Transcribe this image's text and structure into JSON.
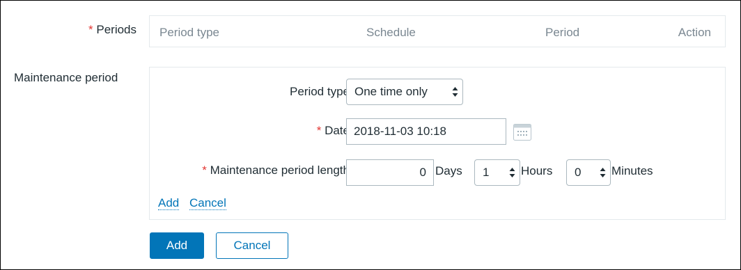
{
  "periods": {
    "required_mark": "*",
    "label": "Periods",
    "columns": [
      "Period type",
      "Schedule",
      "Period",
      "Action"
    ]
  },
  "maintenance_period": {
    "label": "Maintenance period",
    "period_type": {
      "label": "Period type",
      "value": "One time only"
    },
    "date": {
      "required_mark": "*",
      "label": "Date",
      "value": "2018-11-03 10:18"
    },
    "length": {
      "required_mark": "*",
      "label": "Maintenance period length",
      "days_value": "0",
      "days_unit": "Days",
      "hours_value": "1",
      "hours_unit": "Hours",
      "minutes_value": "0",
      "minutes_unit": "Minutes"
    },
    "links": {
      "add": "Add",
      "cancel": "Cancel"
    }
  },
  "buttons": {
    "add": "Add",
    "cancel": "Cancel"
  },
  "colors": {
    "accent": "#0275b8",
    "required": "#e33734",
    "border": "#abb8bf",
    "muted_text": "#7a8791"
  },
  "icons": {
    "calendar": "calendar-icon",
    "select_arrows": "up-down-arrows-icon"
  }
}
